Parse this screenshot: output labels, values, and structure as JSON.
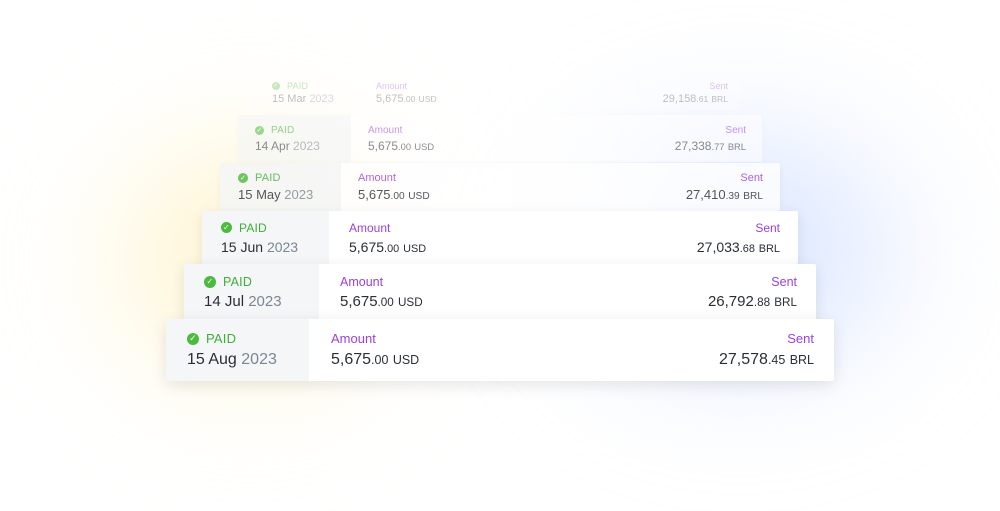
{
  "payments": [
    {
      "status": "PAID",
      "day_month": "15 Mar",
      "year": "2023",
      "amount_label": "Amount",
      "amount_int": "5,675",
      "amount_cents": ".00",
      "amount_currency": "USD",
      "sent_label": "Sent",
      "sent_int": "29,158",
      "sent_cents": ".61",
      "sent_currency": "BRL"
    },
    {
      "status": "PAID",
      "day_month": "14 Apr",
      "year": "2023",
      "amount_label": "Amount",
      "amount_int": "5,675",
      "amount_cents": ".00",
      "amount_currency": "USD",
      "sent_label": "Sent",
      "sent_int": "27,338",
      "sent_cents": ".77",
      "sent_currency": "BRL"
    },
    {
      "status": "PAID",
      "day_month": "15 May",
      "year": "2023",
      "amount_label": "Amount",
      "amount_int": "5,675",
      "amount_cents": ".00",
      "amount_currency": "USD",
      "sent_label": "Sent",
      "sent_int": "27,410",
      "sent_cents": ".39",
      "sent_currency": "BRL"
    },
    {
      "status": "PAID",
      "day_month": "15 Jun",
      "year": "2023",
      "amount_label": "Amount",
      "amount_int": "5,675",
      "amount_cents": ".00",
      "amount_currency": "USD",
      "sent_label": "Sent",
      "sent_int": "27,033",
      "sent_cents": ".68",
      "sent_currency": "BRL"
    },
    {
      "status": "PAID",
      "day_month": "14 Jul",
      "year": "2023",
      "amount_label": "Amount",
      "amount_int": "5,675",
      "amount_cents": ".00",
      "amount_currency": "USD",
      "sent_label": "Sent",
      "sent_int": "26,792",
      "sent_cents": ".88",
      "sent_currency": "BRL"
    },
    {
      "status": "PAID",
      "day_month": "15 Aug",
      "year": "2023",
      "amount_label": "Amount",
      "amount_int": "5,675",
      "amount_cents": ".00",
      "amount_currency": "USD",
      "sent_label": "Sent",
      "sent_int": "27,578",
      "sent_cents": ".45",
      "sent_currency": "BRL"
    }
  ],
  "status_icon": "check-circle-icon",
  "colors": {
    "paid_green": "#3fae3a",
    "label_purple": "#9a42d8",
    "text_dark": "#2a2f36",
    "year_gray": "#7b8794",
    "left_panel_bg": "#f4f6f8"
  }
}
